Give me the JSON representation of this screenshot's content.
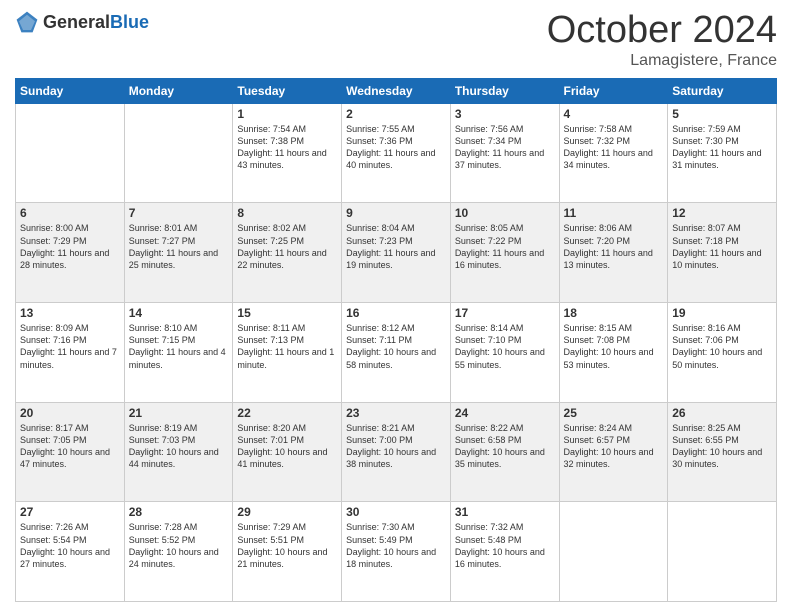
{
  "header": {
    "logo_general": "General",
    "logo_blue": "Blue",
    "month_title": "October 2024",
    "location": "Lamagistere, France"
  },
  "days_of_week": [
    "Sunday",
    "Monday",
    "Tuesday",
    "Wednesday",
    "Thursday",
    "Friday",
    "Saturday"
  ],
  "weeks": [
    [
      {
        "day": "",
        "sunrise": "",
        "sunset": "",
        "daylight": ""
      },
      {
        "day": "",
        "sunrise": "",
        "sunset": "",
        "daylight": ""
      },
      {
        "day": "1",
        "sunrise": "Sunrise: 7:54 AM",
        "sunset": "Sunset: 7:38 PM",
        "daylight": "Daylight: 11 hours and 43 minutes."
      },
      {
        "day": "2",
        "sunrise": "Sunrise: 7:55 AM",
        "sunset": "Sunset: 7:36 PM",
        "daylight": "Daylight: 11 hours and 40 minutes."
      },
      {
        "day": "3",
        "sunrise": "Sunrise: 7:56 AM",
        "sunset": "Sunset: 7:34 PM",
        "daylight": "Daylight: 11 hours and 37 minutes."
      },
      {
        "day": "4",
        "sunrise": "Sunrise: 7:58 AM",
        "sunset": "Sunset: 7:32 PM",
        "daylight": "Daylight: 11 hours and 34 minutes."
      },
      {
        "day": "5",
        "sunrise": "Sunrise: 7:59 AM",
        "sunset": "Sunset: 7:30 PM",
        "daylight": "Daylight: 11 hours and 31 minutes."
      }
    ],
    [
      {
        "day": "6",
        "sunrise": "Sunrise: 8:00 AM",
        "sunset": "Sunset: 7:29 PM",
        "daylight": "Daylight: 11 hours and 28 minutes."
      },
      {
        "day": "7",
        "sunrise": "Sunrise: 8:01 AM",
        "sunset": "Sunset: 7:27 PM",
        "daylight": "Daylight: 11 hours and 25 minutes."
      },
      {
        "day": "8",
        "sunrise": "Sunrise: 8:02 AM",
        "sunset": "Sunset: 7:25 PM",
        "daylight": "Daylight: 11 hours and 22 minutes."
      },
      {
        "day": "9",
        "sunrise": "Sunrise: 8:04 AM",
        "sunset": "Sunset: 7:23 PM",
        "daylight": "Daylight: 11 hours and 19 minutes."
      },
      {
        "day": "10",
        "sunrise": "Sunrise: 8:05 AM",
        "sunset": "Sunset: 7:22 PM",
        "daylight": "Daylight: 11 hours and 16 minutes."
      },
      {
        "day": "11",
        "sunrise": "Sunrise: 8:06 AM",
        "sunset": "Sunset: 7:20 PM",
        "daylight": "Daylight: 11 hours and 13 minutes."
      },
      {
        "day": "12",
        "sunrise": "Sunrise: 8:07 AM",
        "sunset": "Sunset: 7:18 PM",
        "daylight": "Daylight: 11 hours and 10 minutes."
      }
    ],
    [
      {
        "day": "13",
        "sunrise": "Sunrise: 8:09 AM",
        "sunset": "Sunset: 7:16 PM",
        "daylight": "Daylight: 11 hours and 7 minutes."
      },
      {
        "day": "14",
        "sunrise": "Sunrise: 8:10 AM",
        "sunset": "Sunset: 7:15 PM",
        "daylight": "Daylight: 11 hours and 4 minutes."
      },
      {
        "day": "15",
        "sunrise": "Sunrise: 8:11 AM",
        "sunset": "Sunset: 7:13 PM",
        "daylight": "Daylight: 11 hours and 1 minute."
      },
      {
        "day": "16",
        "sunrise": "Sunrise: 8:12 AM",
        "sunset": "Sunset: 7:11 PM",
        "daylight": "Daylight: 10 hours and 58 minutes."
      },
      {
        "day": "17",
        "sunrise": "Sunrise: 8:14 AM",
        "sunset": "Sunset: 7:10 PM",
        "daylight": "Daylight: 10 hours and 55 minutes."
      },
      {
        "day": "18",
        "sunrise": "Sunrise: 8:15 AM",
        "sunset": "Sunset: 7:08 PM",
        "daylight": "Daylight: 10 hours and 53 minutes."
      },
      {
        "day": "19",
        "sunrise": "Sunrise: 8:16 AM",
        "sunset": "Sunset: 7:06 PM",
        "daylight": "Daylight: 10 hours and 50 minutes."
      }
    ],
    [
      {
        "day": "20",
        "sunrise": "Sunrise: 8:17 AM",
        "sunset": "Sunset: 7:05 PM",
        "daylight": "Daylight: 10 hours and 47 minutes."
      },
      {
        "day": "21",
        "sunrise": "Sunrise: 8:19 AM",
        "sunset": "Sunset: 7:03 PM",
        "daylight": "Daylight: 10 hours and 44 minutes."
      },
      {
        "day": "22",
        "sunrise": "Sunrise: 8:20 AM",
        "sunset": "Sunset: 7:01 PM",
        "daylight": "Daylight: 10 hours and 41 minutes."
      },
      {
        "day": "23",
        "sunrise": "Sunrise: 8:21 AM",
        "sunset": "Sunset: 7:00 PM",
        "daylight": "Daylight: 10 hours and 38 minutes."
      },
      {
        "day": "24",
        "sunrise": "Sunrise: 8:22 AM",
        "sunset": "Sunset: 6:58 PM",
        "daylight": "Daylight: 10 hours and 35 minutes."
      },
      {
        "day": "25",
        "sunrise": "Sunrise: 8:24 AM",
        "sunset": "Sunset: 6:57 PM",
        "daylight": "Daylight: 10 hours and 32 minutes."
      },
      {
        "day": "26",
        "sunrise": "Sunrise: 8:25 AM",
        "sunset": "Sunset: 6:55 PM",
        "daylight": "Daylight: 10 hours and 30 minutes."
      }
    ],
    [
      {
        "day": "27",
        "sunrise": "Sunrise: 7:26 AM",
        "sunset": "Sunset: 5:54 PM",
        "daylight": "Daylight: 10 hours and 27 minutes."
      },
      {
        "day": "28",
        "sunrise": "Sunrise: 7:28 AM",
        "sunset": "Sunset: 5:52 PM",
        "daylight": "Daylight: 10 hours and 24 minutes."
      },
      {
        "day": "29",
        "sunrise": "Sunrise: 7:29 AM",
        "sunset": "Sunset: 5:51 PM",
        "daylight": "Daylight: 10 hours and 21 minutes."
      },
      {
        "day": "30",
        "sunrise": "Sunrise: 7:30 AM",
        "sunset": "Sunset: 5:49 PM",
        "daylight": "Daylight: 10 hours and 18 minutes."
      },
      {
        "day": "31",
        "sunrise": "Sunrise: 7:32 AM",
        "sunset": "Sunset: 5:48 PM",
        "daylight": "Daylight: 10 hours and 16 minutes."
      },
      {
        "day": "",
        "sunrise": "",
        "sunset": "",
        "daylight": ""
      },
      {
        "day": "",
        "sunrise": "",
        "sunset": "",
        "daylight": ""
      }
    ]
  ]
}
